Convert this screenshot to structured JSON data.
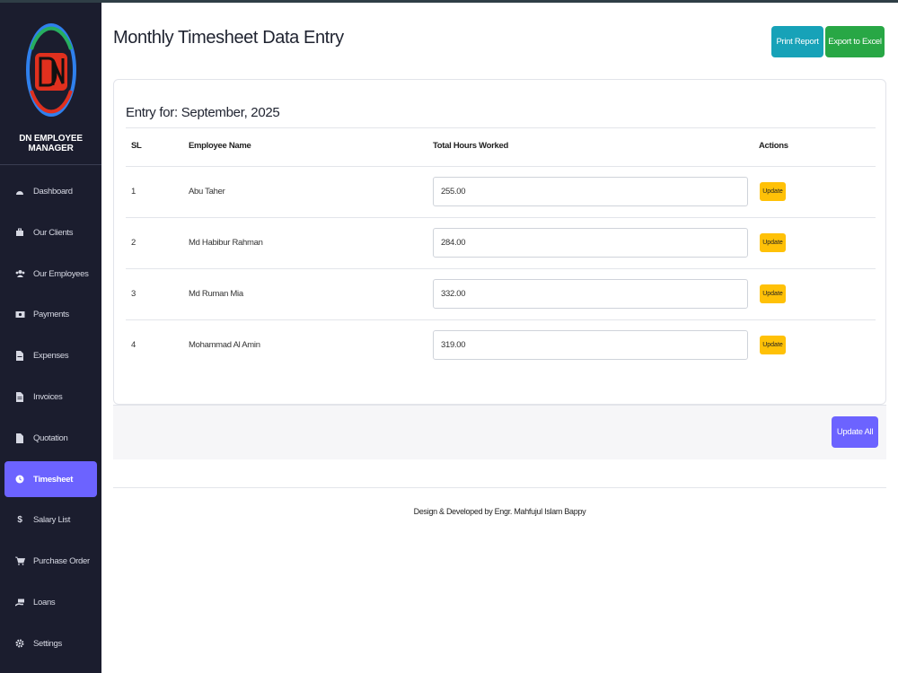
{
  "app": {
    "brand": "DN EMPLOYEE MANAGER"
  },
  "sidebar": {
    "items": [
      {
        "label": "Dashboard",
        "icon": "dashboard-icon",
        "active": false
      },
      {
        "label": "Our Clients",
        "icon": "briefcase-icon",
        "active": false
      },
      {
        "label": "Our Employees",
        "icon": "users-icon",
        "active": false
      },
      {
        "label": "Payments",
        "icon": "money-icon",
        "active": false
      },
      {
        "label": "Expenses",
        "icon": "file-invoice-icon",
        "active": false
      },
      {
        "label": "Invoices",
        "icon": "file-icon",
        "active": false
      },
      {
        "label": "Quotation",
        "icon": "file-alt-icon",
        "active": false
      },
      {
        "label": "Timesheet",
        "icon": "clock-icon",
        "active": true
      },
      {
        "label": "Salary List",
        "icon": "dollar-icon",
        "active": false
      },
      {
        "label": "Purchase Order",
        "icon": "cart-icon",
        "active": false
      },
      {
        "label": "Loans",
        "icon": "hand-money-icon",
        "active": false
      },
      {
        "label": "Settings",
        "icon": "gear-icon",
        "active": false
      }
    ]
  },
  "header": {
    "title": "Monthly Timesheet Data Entry",
    "print_label": "Print Report",
    "export_label": "Export to Excel"
  },
  "entry": {
    "title": "Entry for: September, 2025",
    "columns": {
      "sl": "SL",
      "name": "Employee Name",
      "hours": "Total Hours Worked",
      "actions": "Actions"
    },
    "rows": [
      {
        "sl": "1",
        "name": "Abu Taher",
        "hours": "255.00",
        "action": "Update"
      },
      {
        "sl": "2",
        "name": "Md Habibur Rahman",
        "hours": "284.00",
        "action": "Update"
      },
      {
        "sl": "3",
        "name": "Md Ruman Mia",
        "hours": "332.00",
        "action": "Update"
      },
      {
        "sl": "4",
        "name": "Mohammad Al Amin",
        "hours": "319.00",
        "action": "Update"
      }
    ],
    "update_all_label": "Update All"
  },
  "footer": {
    "credit": "Design & Developed by Engr. Mahfujul Islam Bappy"
  },
  "colors": {
    "sidebar_bg": "#1b1d2e",
    "accent": "#6c63ff",
    "print": "#17a2b8",
    "excel": "#28a745",
    "update": "#ffc107"
  }
}
